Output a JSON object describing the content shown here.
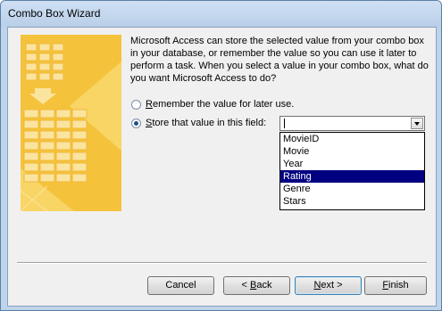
{
  "window": {
    "title": "Combo Box Wizard"
  },
  "message": "Microsoft Access can store the selected value from your combo box in your database, or remember the value so you can use it later to perform a task.  When you select a value in your combo box, what do you want Microsoft Access to do?",
  "options": {
    "remember": {
      "label_pre": "",
      "label_accel": "R",
      "label_post": "emember the value for later use.",
      "selected": false
    },
    "store": {
      "label_pre": "",
      "label_accel": "S",
      "label_post": "tore that value in this field:",
      "selected": true
    }
  },
  "field_combo": {
    "value": "",
    "list": [
      "MovieID",
      "Movie",
      "Year",
      "Rating",
      "Genre",
      "Stars"
    ],
    "highlighted": "Rating"
  },
  "buttons": {
    "cancel": {
      "label": "Cancel"
    },
    "back": {
      "pre": "< ",
      "accel": "B",
      "post": "ack"
    },
    "next": {
      "pre": "",
      "accel": "N",
      "post": "ext >"
    },
    "finish": {
      "pre": "",
      "accel": "F",
      "post": "inish"
    }
  },
  "colors": {
    "illustration": "#f5c33b",
    "selection": "#000080",
    "title_bar": "#bfd3ea"
  }
}
